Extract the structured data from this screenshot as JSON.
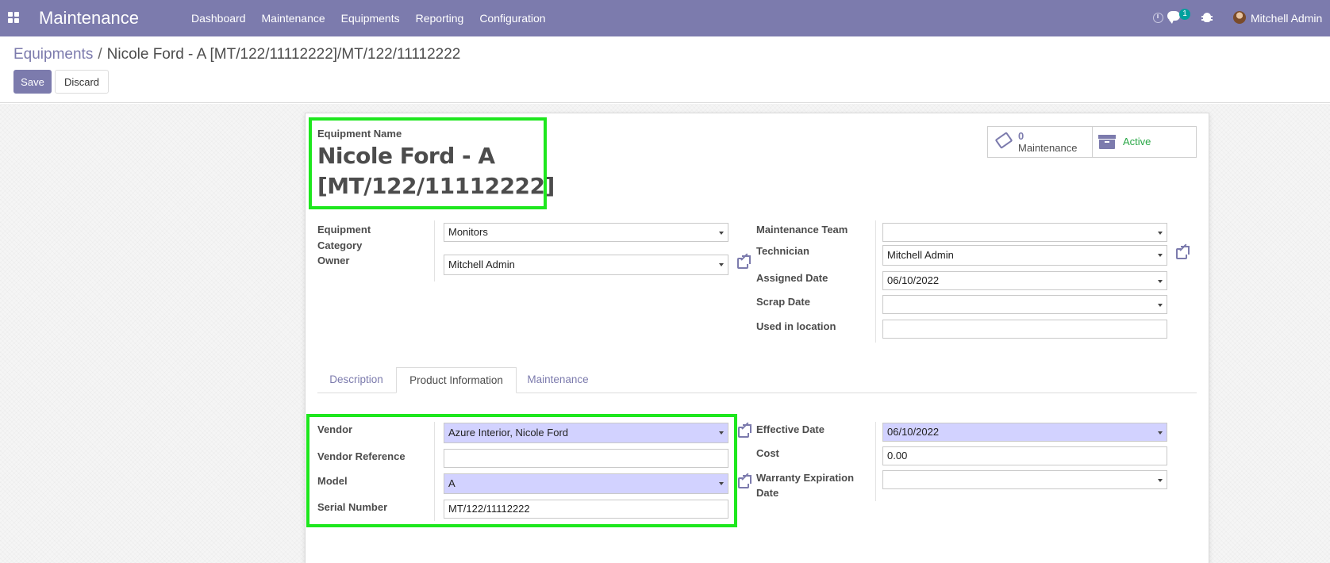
{
  "navbar": {
    "app_title": "Maintenance",
    "menu": [
      "Dashboard",
      "Maintenance",
      "Equipments",
      "Reporting",
      "Configuration"
    ],
    "chat_badge": "1",
    "user_name": "Mitchell Admin",
    "icons": [
      "apps-icon",
      "clock-icon",
      "chat-icon",
      "bug-icon",
      "avatar"
    ]
  },
  "breadcrumb": {
    "parent": "Equipments",
    "separator": "/",
    "current": "Nicole Ford - A [MT/122/11112222]/MT/122/11112222"
  },
  "buttons": {
    "save": "Save",
    "discard": "Discard"
  },
  "form": {
    "name_label": "Equipment Name",
    "name_line1": "Nicole Ford - A",
    "name_line2": "[MT/122/11112222]",
    "smart": {
      "maintenance_count": "0",
      "maintenance_label": "Maintenance",
      "active_label": "Active"
    },
    "left": {
      "category_label_1": "Equipment",
      "category_label_2": "Category",
      "category_value": "Monitors",
      "owner_label": "Owner",
      "owner_value": "Mitchell Admin"
    },
    "right": {
      "team_label": "Maintenance Team",
      "team_value": "",
      "technician_label": "Technician",
      "technician_value": "Mitchell Admin",
      "assigned_label": "Assigned Date",
      "assigned_value": "06/10/2022",
      "scrap_label": "Scrap Date",
      "scrap_value": "",
      "location_label": "Used in location",
      "location_value": ""
    },
    "tabs": [
      "Description",
      "Product Information",
      "Maintenance"
    ],
    "active_tab": "Product Information",
    "product": {
      "vendor_label": "Vendor",
      "vendor_value": "Azure Interior, Nicole Ford",
      "vendor_ref_label": "Vendor Reference",
      "vendor_ref_value": "",
      "model_label": "Model",
      "model_value": "A",
      "serial_label": "Serial Number",
      "serial_value": "MT/122/11112222",
      "effective_label": "Effective Date",
      "effective_value": "06/10/2022",
      "cost_label": "Cost",
      "cost_value": "0.00",
      "warranty_label_1": "Warranty Expiration",
      "warranty_label_2": "Date",
      "warranty_value": ""
    }
  },
  "colors": {
    "navbar": "#7c7bad",
    "highlight": "#1ee71e",
    "required_field": "#d2d2ff",
    "active_status": "#28a745"
  }
}
